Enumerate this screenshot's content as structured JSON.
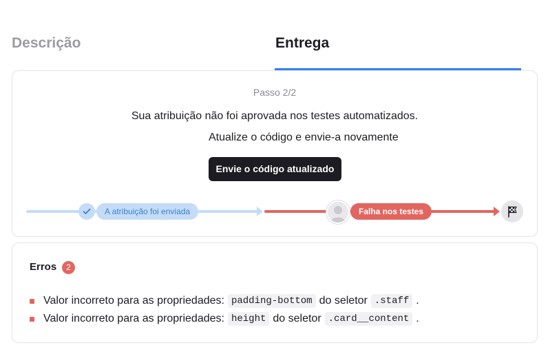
{
  "tabs": [
    {
      "label": "Descrição",
      "active": false
    },
    {
      "label": "Entrega",
      "active": true
    }
  ],
  "submission": {
    "step": "Passo 2/2",
    "message_line1": "Sua atribuição não foi aprovada nos testes automatizados.",
    "message_line2": "Atualize o código e envie-a novamente",
    "submit_button": "Envie o código atualizado"
  },
  "progress": {
    "step1_label": "A atribuição foi enviada",
    "step2_label": "Falha nos testes",
    "colors": {
      "done": "#c5dcf6",
      "failed": "#e2665f"
    }
  },
  "errors": {
    "title": "Erros",
    "count": "2",
    "items": [
      {
        "prefix": "Valor incorreto para as propriedades:",
        "property": "padding-bottom",
        "middle": "do seletor",
        "selector": ".staff",
        "suffix": "."
      },
      {
        "prefix": "Valor incorreto para as propriedades:",
        "property": "height",
        "middle": "do seletor",
        "selector": ".card__content",
        "suffix": "."
      }
    ]
  },
  "icons": {
    "check": "check-icon",
    "avatar": "user-avatar-icon",
    "finish": "checkered-flag-icon"
  }
}
